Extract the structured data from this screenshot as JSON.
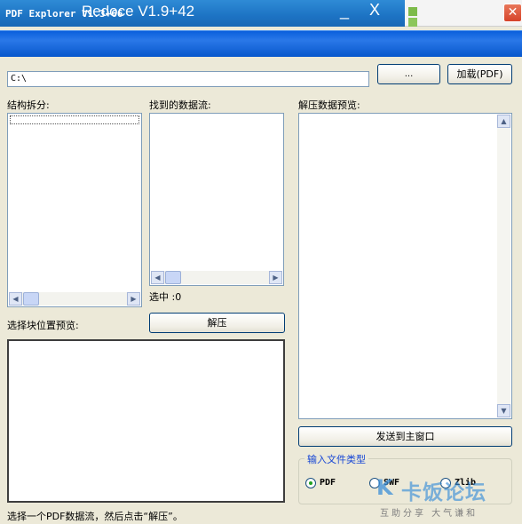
{
  "background_window": {
    "title": "Redoce V1.9+42",
    "minimize": "_",
    "close": "X"
  },
  "window": {
    "title": "PDF Explorer V1.3+66",
    "close": "✕"
  },
  "path": {
    "value": "C:\\"
  },
  "buttons": {
    "browse": "...",
    "load": "加载(PDF)",
    "decompress": "解压",
    "send": "发送到主窗口"
  },
  "labels": {
    "structure": "结构拆分:",
    "streams_found": "找到的数据流:",
    "decompressed_preview": "解压数据预览:",
    "selected": "选中 :0",
    "block_preview": "选择块位置预览:"
  },
  "file_type": {
    "title": "输入文件类型",
    "options": [
      {
        "label": "PDF",
        "selected": true
      },
      {
        "label": "SWF",
        "selected": false
      },
      {
        "label": "Zlib",
        "selected": false
      }
    ]
  },
  "status": "选择一个PDF数据流，然后点击“解压”。",
  "watermark": {
    "brand": "卡饭论坛",
    "slogan": "互助分享  大气谦和"
  }
}
